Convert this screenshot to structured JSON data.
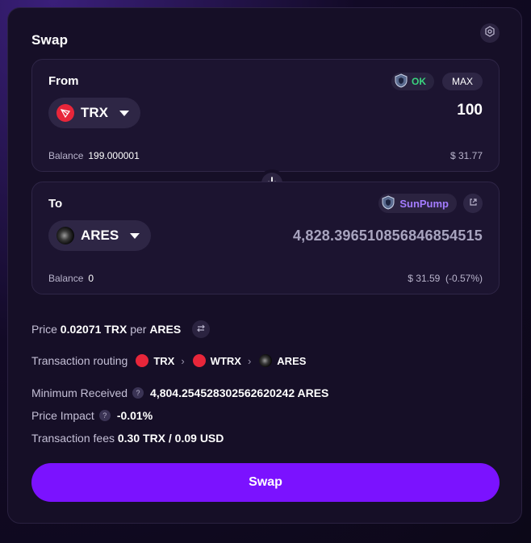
{
  "header": {
    "title": "Swap"
  },
  "from": {
    "label": "From",
    "ok_badge": "OK",
    "max_label": "MAX",
    "token": "TRX",
    "amount": "100",
    "balance_label": "Balance",
    "balance_value": "199.000001",
    "usd_value": "$ 31.77"
  },
  "to": {
    "label": "To",
    "source_badge": "SunPump",
    "token": "ARES",
    "amount": "4,828.396510856846854515",
    "balance_label": "Balance",
    "balance_value": "0",
    "usd_value": "$ 31.59  (-0.57%)"
  },
  "price": {
    "prefix": "Price",
    "value": "0.02071 TRX",
    "per": "per",
    "token": "ARES"
  },
  "routing": {
    "label": "Transaction routing",
    "steps": [
      "TRX",
      "WTRX",
      "ARES"
    ]
  },
  "minimum_received": {
    "label": "Minimum Received",
    "value": "4,804.254528302562620242 ARES"
  },
  "price_impact": {
    "label": "Price Impact",
    "value": "-0.01%"
  },
  "fees": {
    "label": "Transaction fees",
    "value": "0.30 TRX / 0.09 USD"
  },
  "action": {
    "swap_label": "Swap"
  },
  "icons": {
    "settings": "settings-icon",
    "switch": "arrow-down-icon",
    "shield": "shield-icon",
    "external": "external-link-icon",
    "swap_rate": "swap-arrows-icon",
    "help": "help-icon"
  },
  "colors": {
    "accent": "#7b12ff",
    "ok": "#3ad47e",
    "sunpump": "#a47cff",
    "trx": "#e8263a"
  }
}
